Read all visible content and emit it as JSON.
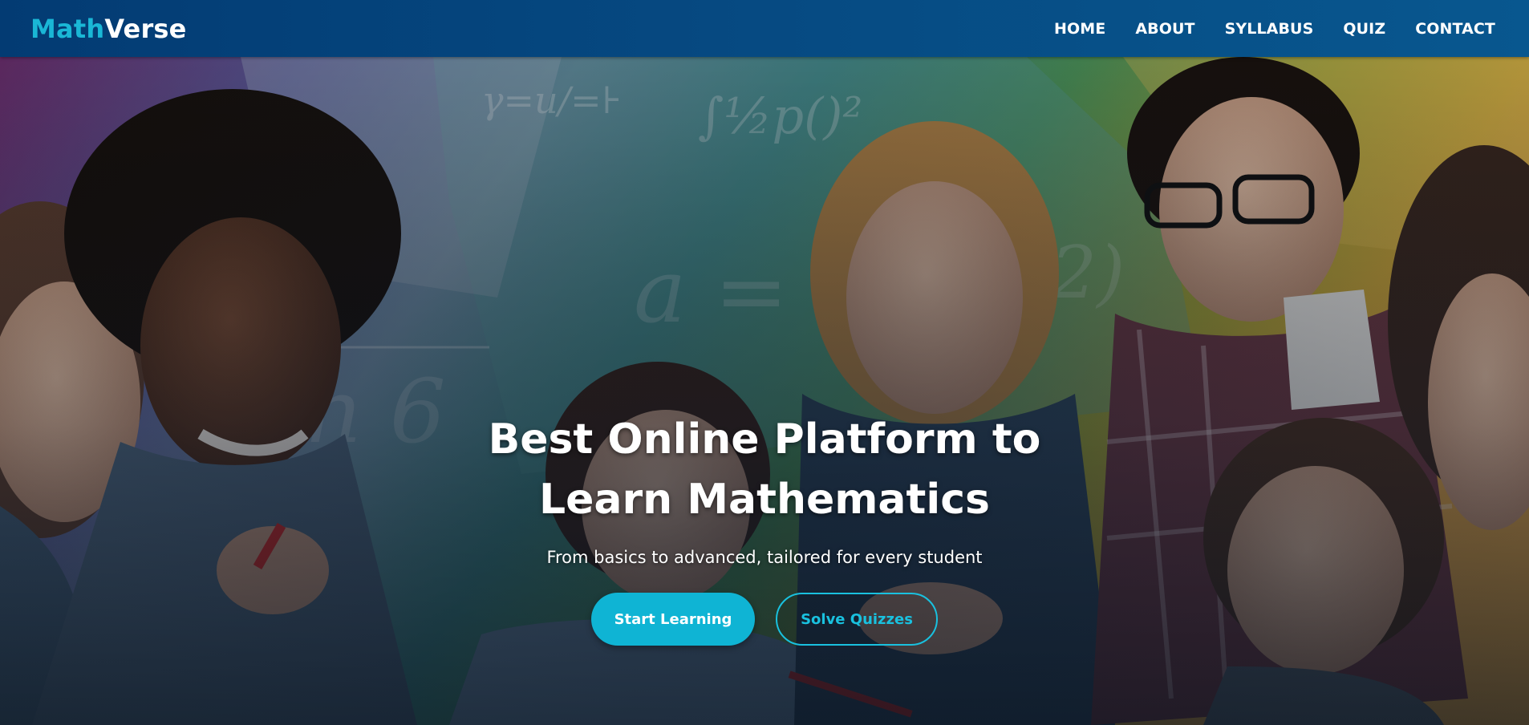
{
  "brand": {
    "name_accent": "Math",
    "name_rest": "Verse"
  },
  "nav": {
    "items": [
      {
        "label": "HOME"
      },
      {
        "label": "ABOUT"
      },
      {
        "label": "SYLLABUS"
      },
      {
        "label": "QUIZ"
      },
      {
        "label": "CONTACT"
      }
    ]
  },
  "hero": {
    "title": "Best Online Platform to Learn Mathematics",
    "subtitle": "From basics to advanced, tailored for every student",
    "primary_button": "Start Learning",
    "secondary_button": "Solve Quizzes",
    "image_description_icon": "students-photo",
    "chalkboard_formulas": [
      "γ=u/=⊦",
      "∫½p()²",
      "a = t",
      "n 6",
      "2)"
    ]
  },
  "colors": {
    "nav_bg": "#064a82",
    "accent": "#1ab7d6",
    "button_primary": "#0fb4d4",
    "text": "#ffffff"
  }
}
